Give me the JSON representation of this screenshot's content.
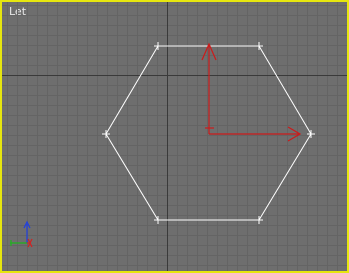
{
  "viewport": {
    "label": "Let",
    "border_color": "#e6e60f",
    "background_color": "#6e6e6e",
    "grid_color": "#646464",
    "grid_major_color": "#3a3a3a",
    "object_color": "#ffffff",
    "gizmo_color": "#cc1a1a"
  },
  "axis_tripod": {
    "axes": [
      "x",
      "y",
      "z"
    ],
    "colors": {
      "x": "#d42020",
      "y": "#1fb21f",
      "z": "#2040e0"
    }
  },
  "object": {
    "shape": "hexagon",
    "state": "selected"
  }
}
